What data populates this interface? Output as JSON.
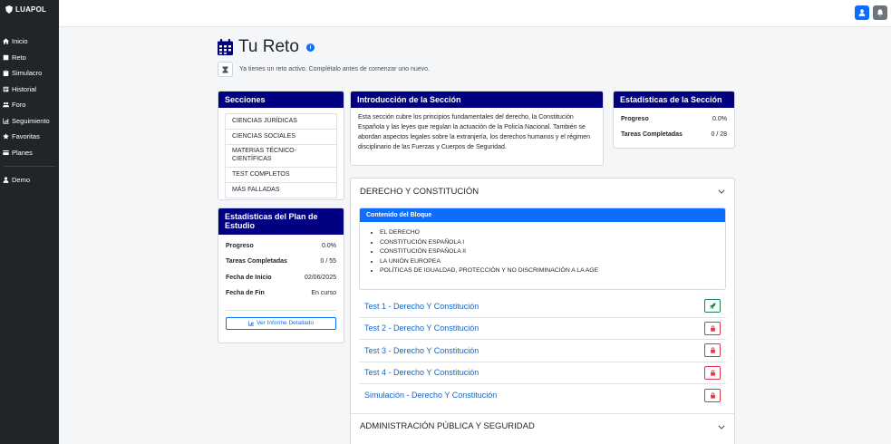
{
  "brand": "LUAPOL",
  "nav": [
    {
      "label": "Inicio",
      "icon": "home-icon"
    },
    {
      "label": "Reto",
      "icon": "book-icon"
    },
    {
      "label": "Simulacro",
      "icon": "clipboard-icon"
    },
    {
      "label": "Historial",
      "icon": "history-icon"
    },
    {
      "label": "Foro",
      "icon": "users-icon"
    },
    {
      "label": "Seguimiento",
      "icon": "chart-icon"
    },
    {
      "label": "Favoritas",
      "icon": "star-icon"
    },
    {
      "label": "Planes",
      "icon": "card-icon"
    }
  ],
  "user": {
    "label": "Demo",
    "icon": "user-icon"
  },
  "header": {
    "title": "Tu Reto",
    "notice": "Ya tienes un reto activo. Complétalo antes de comenzar uno nuevo."
  },
  "secciones": {
    "title": "Secciones",
    "items": [
      "CIENCIAS JURÍDICAS",
      "CIENCIAS SOCIALES",
      "MATERIAS TÉCNICO-CIENTÍFICAS",
      "TEST COMPLETOS",
      "MÁS FALLADAS"
    ]
  },
  "plan": {
    "title": "Estadísticas del Plan de Estudio",
    "progreso_label": "Progreso",
    "progreso": "0.0%",
    "tareas_label": "Tareas Completadas",
    "tareas": "0 / 55",
    "inicio_label": "Fecha de Inicio",
    "inicio": "02/06/2025",
    "fin_label": "Fecha de Fin",
    "fin": "En curso",
    "report_button": "Ver Informe Detallado"
  },
  "intro": {
    "title": "Introducción de la Sección",
    "text": "Esta sección cubre los principios fundamentales del derecho, la Constitución Española y las leyes que regulan la actuación de la Policía Nacional. También se abordan aspectos legales sobre la extranjería, los derechos humanos y el régimen disciplinario de las Fuerzas y Cuerpos de Seguridad."
  },
  "secstats": {
    "title": "Estadísticas de la Sección",
    "progreso_label": "Progreso",
    "progreso": "0.0%",
    "tareas_label": "Tareas Completadas",
    "tareas": "0 / 28"
  },
  "accordion": {
    "block1": "DERECHO Y CONSTITUCIÓN",
    "content_title": "Contenido del Bloque",
    "content_items": [
      "EL DERECHO",
      "CONSTITUCIÓN ESPAÑOLA I",
      "CONSTITUCIÓN ESPAÑOLA II",
      "LA UNIÓN EUROPEA",
      "POLÍTICAS DE IGUALDAD, PROTECCIÓN Y NO DISCRIMINACIÓN A LA AGE"
    ],
    "tests": [
      {
        "label": "Test 1 - Derecho Y Constitución",
        "state": "available"
      },
      {
        "label": "Test 2 - Derecho Y Constitución",
        "state": "locked"
      },
      {
        "label": "Test 3 - Derecho Y Constitución",
        "state": "locked"
      },
      {
        "label": "Test 4 - Derecho Y Constitución",
        "state": "locked"
      },
      {
        "label": "Simulación - Derecho Y Constitución",
        "state": "locked"
      }
    ],
    "block2": "ADMINISTRACIÓN PÚBLICA Y SEGURIDAD"
  },
  "colors": {
    "sidebar": "#212529",
    "card_header": "#000080",
    "primary": "#0d6efd",
    "success": "#198754",
    "danger": "#dc3545"
  }
}
